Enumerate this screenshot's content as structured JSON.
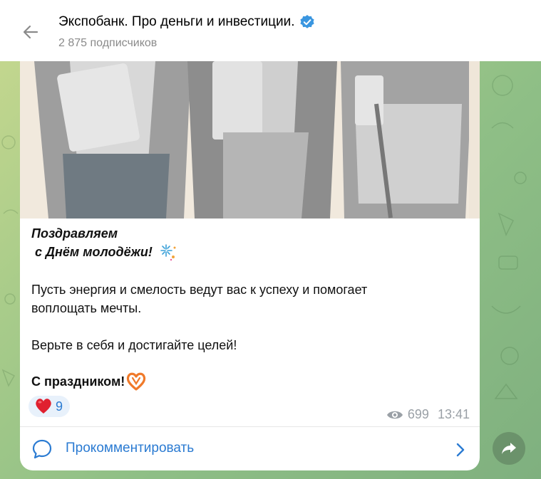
{
  "header": {
    "title": "Экспобанк. Про деньги и инвестиции.",
    "subscribers": "2 875 подписчиков"
  },
  "post": {
    "greeting_line1": "Поздравляем",
    "greeting_line2": " с Днём молодёжи! ",
    "paragraph1_line1": "Пусть энергия и смелость ведут вас к успеху и помогает",
    "paragraph1_line2": "воплощать мечты.",
    "paragraph2": "Верьте в себя и достигайте целей!",
    "closing": "С праздником!",
    "reaction": {
      "emoji": "heart",
      "count": "9"
    },
    "views": "699",
    "time": "13:41",
    "comment_label": "Прокомментировать"
  },
  "colors": {
    "accent": "#2b7bd2",
    "heart": "#e0202f",
    "meta": "#9aa0a6"
  }
}
